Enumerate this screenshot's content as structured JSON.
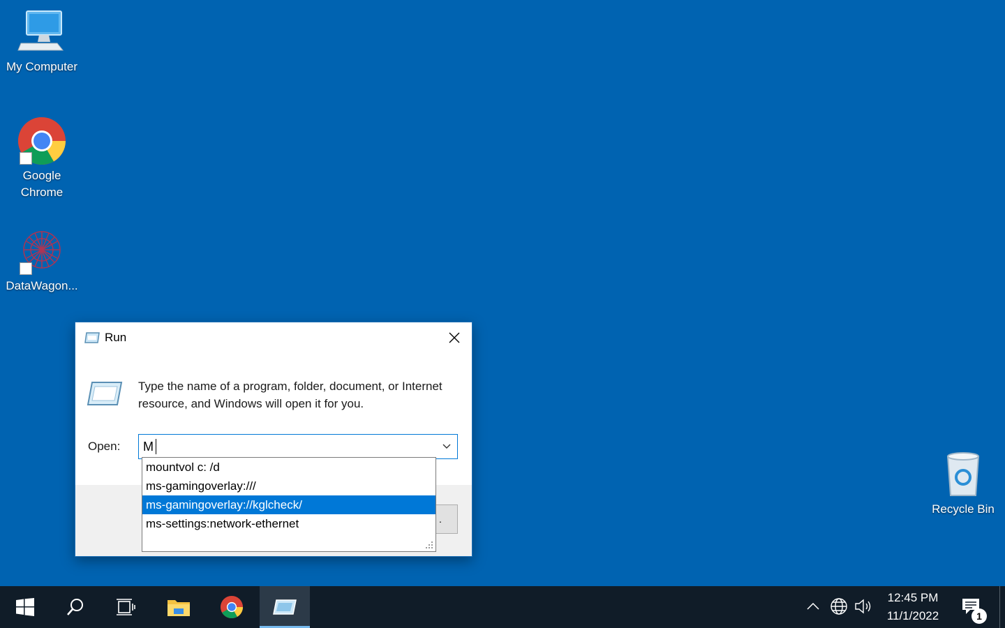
{
  "desktop": {
    "icons": [
      {
        "label": "My Computer",
        "icon": "computer-icon"
      },
      {
        "label": "Google\nChrome",
        "icon": "chrome-icon"
      },
      {
        "label": "DataWagon...",
        "icon": "datawagon-icon"
      },
      {
        "label": "Recycle Bin",
        "icon": "recycle-bin-icon"
      }
    ],
    "background_color": "#0063B1"
  },
  "run_dialog": {
    "title": "Run",
    "description": "Type the name of a program, folder, document, or Internet resource, and Windows will open it for you.",
    "open_label": "Open:",
    "open_value": "M",
    "autocomplete": [
      "mountvol c: /d",
      "ms-gamingoverlay:///",
      "ms-gamingoverlay://kglcheck/",
      "ms-settings:network-ethernet"
    ],
    "selected_index": 2,
    "partial_button_label": "."
  },
  "taskbar": {
    "apps": [
      "start-icon",
      "search-icon",
      "task-view-icon",
      "file-explorer-icon",
      "chrome-icon",
      "run-icon"
    ],
    "time": "12:45 PM",
    "date": "11/1/2022",
    "notification_count": "1",
    "accent_color": "#76b9ed"
  }
}
